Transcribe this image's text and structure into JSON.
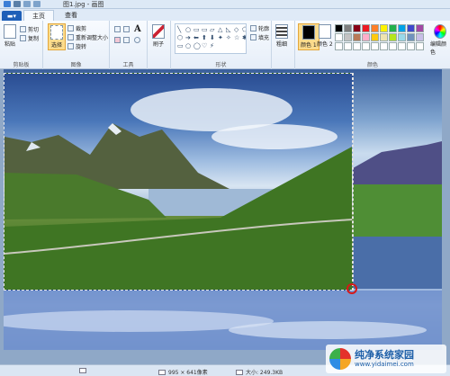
{
  "window": {
    "title": "图1.jpg - 画图"
  },
  "tabs": [
    {
      "label": "主页",
      "active": true
    },
    {
      "label": "查看",
      "active": false
    }
  ],
  "file_tab": {
    "icon": "file-menu-icon"
  },
  "ribbon": {
    "clipboard": {
      "paste_label": "粘贴",
      "cut_label": "剪切",
      "copy_label": "复制",
      "group_label": "剪贴板"
    },
    "image": {
      "select_label": "选择",
      "crop_label": "裁剪",
      "resize_label": "重新调整大小",
      "rotate_label": "旋转",
      "group_label": "图像"
    },
    "tools": {
      "group_label": "工具",
      "text_tool": "A"
    },
    "brushes": {
      "label": "刷子"
    },
    "shapes": {
      "glyphs": [
        "╲",
        "○",
        "▭",
        "▭",
        "▱",
        "△",
        "◺",
        "◇",
        "⬠",
        "⬡",
        "➔",
        "⬅",
        "⬆",
        "⬇",
        "✦",
        "✧",
        "☆",
        "✱",
        "▭",
        "○",
        "◯",
        "♡",
        "⚡"
      ],
      "outline_label": "轮廓",
      "fill_label": "填充",
      "group_label": "形状"
    },
    "size": {
      "label": "粗细"
    },
    "colors": {
      "color1_label": "颜色 1",
      "color2_label": "颜色 2",
      "group_label": "颜色",
      "edit_label": "编辑颜色"
    }
  },
  "palette": [
    "#000000",
    "#7f7f7f",
    "#880015",
    "#ed1c24",
    "#ff7f27",
    "#fff200",
    "#22b14c",
    "#00a2e8",
    "#3f48cc",
    "#a349a4",
    "#ffffff",
    "#c3c3c3",
    "#b97a57",
    "#ffaec9",
    "#ffc90e",
    "#efe4b0",
    "#b5e61d",
    "#99d9ea",
    "#7092be",
    "#c8bfe7",
    "#ffffff",
    "#ffffff",
    "#ffffff",
    "#ffffff",
    "#ffffff",
    "#ffffff",
    "#ffffff",
    "#ffffff",
    "#ffffff",
    "#ffffff"
  ],
  "status": {
    "dimensions": "995 × 641像素",
    "filesize": "大小: 249.3KB"
  },
  "watermark": {
    "title": "纯净系统家园",
    "url": "www.yidaimei.com"
  }
}
